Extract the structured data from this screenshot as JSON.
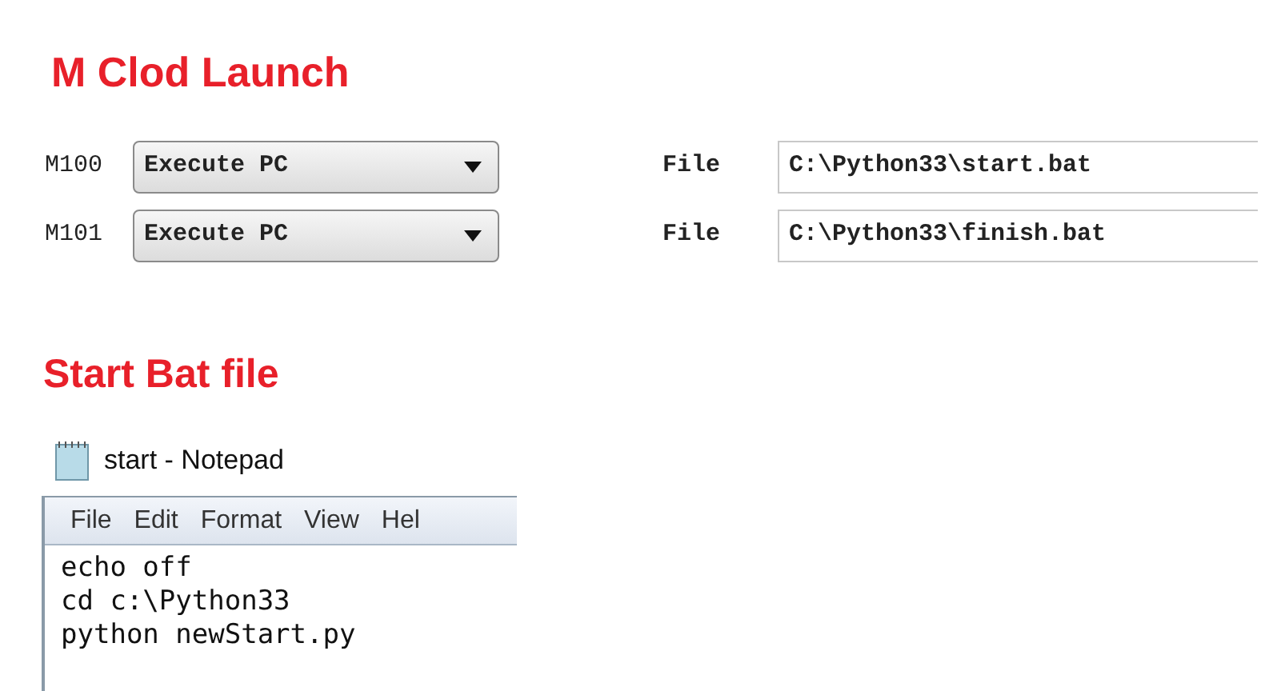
{
  "launch_section": {
    "heading": "M Clod Launch",
    "rows": [
      {
        "code": "M100",
        "action": "Execute PC",
        "file_label": "File",
        "file_path": "C:\\Python33\\start.bat"
      },
      {
        "code": "M101",
        "action": "Execute PC",
        "file_label": "File",
        "file_path": "C:\\Python33\\finish.bat"
      }
    ]
  },
  "bat_section": {
    "heading": "Start Bat file",
    "notepad": {
      "title": "start - Notepad",
      "menu": [
        "File",
        "Edit",
        "Format",
        "View",
        "Hel"
      ],
      "lines": [
        "echo off",
        "cd c:\\Python33",
        "python newStart.py"
      ]
    }
  }
}
